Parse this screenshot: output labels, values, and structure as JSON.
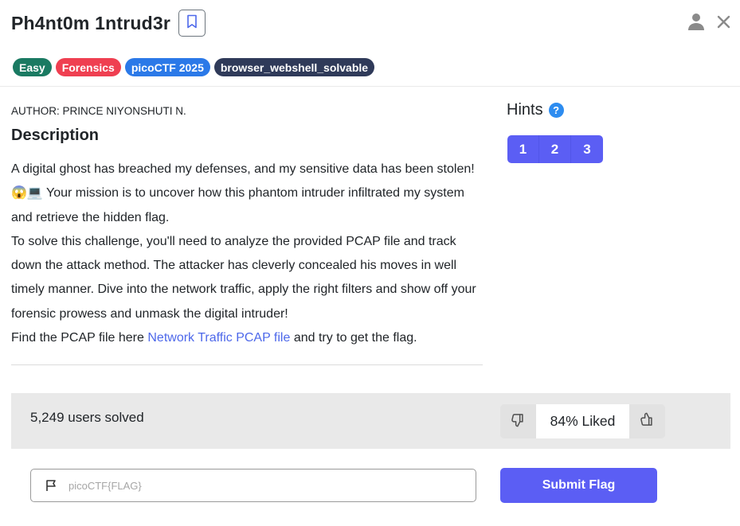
{
  "challenge": {
    "title": "Ph4nt0m 1ntrud3r",
    "tags": [
      {
        "label": "Easy",
        "color": "#1a7a62"
      },
      {
        "label": "Forensics",
        "color": "#ef3f51"
      },
      {
        "label": "picoCTF 2025",
        "color": "#2b79e8"
      },
      {
        "label": "browser_webshell_solvable",
        "color": "#2f3a59"
      }
    ],
    "author": "AUTHOR: PRINCE NIYONSHUTI N.",
    "description_heading": "Description",
    "description": {
      "p1": "A digital ghost has breached my defenses, and my sensitive data has been stolen! 😱💻 Your mission is to uncover how this phantom intruder infiltrated my system and retrieve the hidden flag.",
      "p2": "To solve this challenge, you'll need to analyze the provided PCAP file and track down the attack method. The attacker has cleverly concealed his moves in well timely manner. Dive into the network traffic, apply the right filters and show off your forensic prowess and unmask the digital intruder!",
      "p3_prefix": "Find the PCAP file here ",
      "p3_link": "Network Traffic PCAP file",
      "p3_suffix": " and try to get the flag."
    }
  },
  "hints": {
    "title": "Hints",
    "help_icon": "?",
    "buttons": [
      "1",
      "2",
      "3"
    ]
  },
  "stats": {
    "solved_text": "5,249 users solved",
    "liked_text": "84% Liked"
  },
  "flag_form": {
    "placeholder": "picoCTF{FLAG}",
    "value": "",
    "submit_label": "Submit Flag"
  },
  "icons": {
    "bookmark": "bookmark-icon",
    "user": "user-icon",
    "close": "close-icon",
    "thumbs_down": "thumbs-down-icon",
    "thumbs_up": "thumbs-up-icon",
    "flag": "flag-icon"
  }
}
